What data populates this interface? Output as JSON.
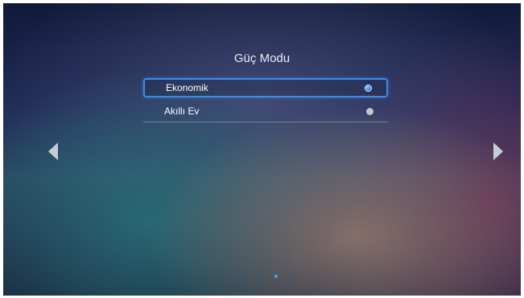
{
  "screen": {
    "title": "Güç Modu"
  },
  "options": [
    {
      "label": "Ekonomik",
      "selected": true,
      "focused": true
    },
    {
      "label": "Akıllı Ev",
      "selected": false,
      "focused": false
    }
  ],
  "navigation": {
    "left_icon": "triangle-left",
    "right_icon": "triangle-right"
  },
  "pagination": {
    "total": 4,
    "active_index": 2
  },
  "colors": {
    "accent": "#3f8ae8",
    "radio_selected": "#3b82e8",
    "radio_unselected": "#c4c4c8"
  }
}
